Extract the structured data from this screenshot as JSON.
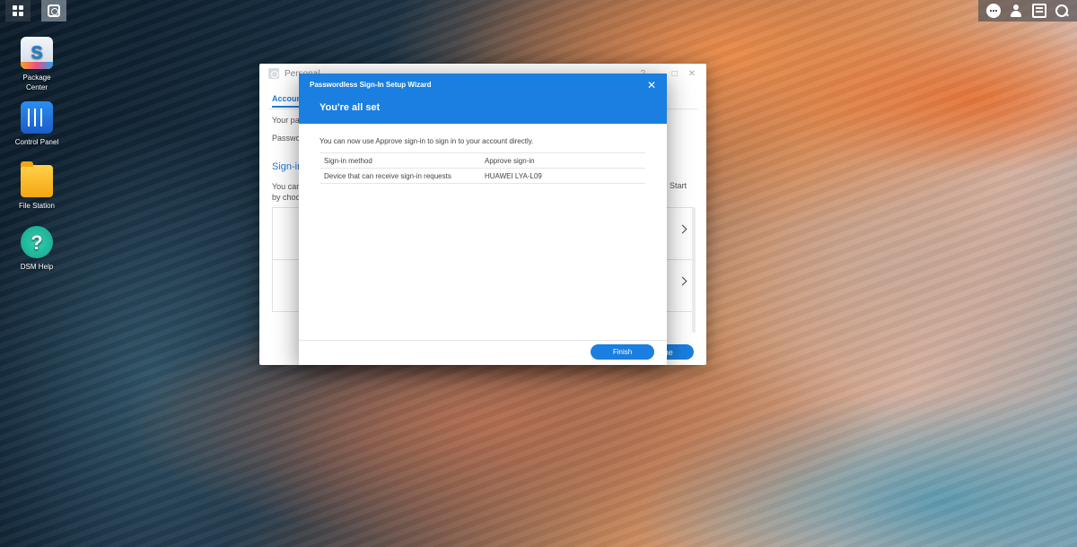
{
  "desktop": {
    "icons": [
      {
        "label": "Package Center"
      },
      {
        "label": "Control Panel"
      },
      {
        "label": "File Station"
      },
      {
        "label": "DSM Help"
      }
    ]
  },
  "background_window": {
    "title": "Personal",
    "tab": "Account",
    "lines": [
      "Your pa",
      "Passwo"
    ],
    "section_title": "Sign-in",
    "section_text": [
      "You can",
      "by choo"
    ],
    "start_text": "Start",
    "done_label": "Done"
  },
  "wizard": {
    "title": "Passwordless Sign-In Setup Wizard",
    "heading": "You're all set",
    "description": "You can now use Approve sign-in to sign in to your account directly.",
    "rows": [
      {
        "key": "Sign-in method",
        "value": "Approve sign-in"
      },
      {
        "key": "Device that can receive sign-in requests",
        "value": "HUAWEI LYA-L09"
      }
    ],
    "finish_label": "Finish",
    "close_glyph": "✕"
  },
  "colors": {
    "accent": "#1a7fe0"
  }
}
